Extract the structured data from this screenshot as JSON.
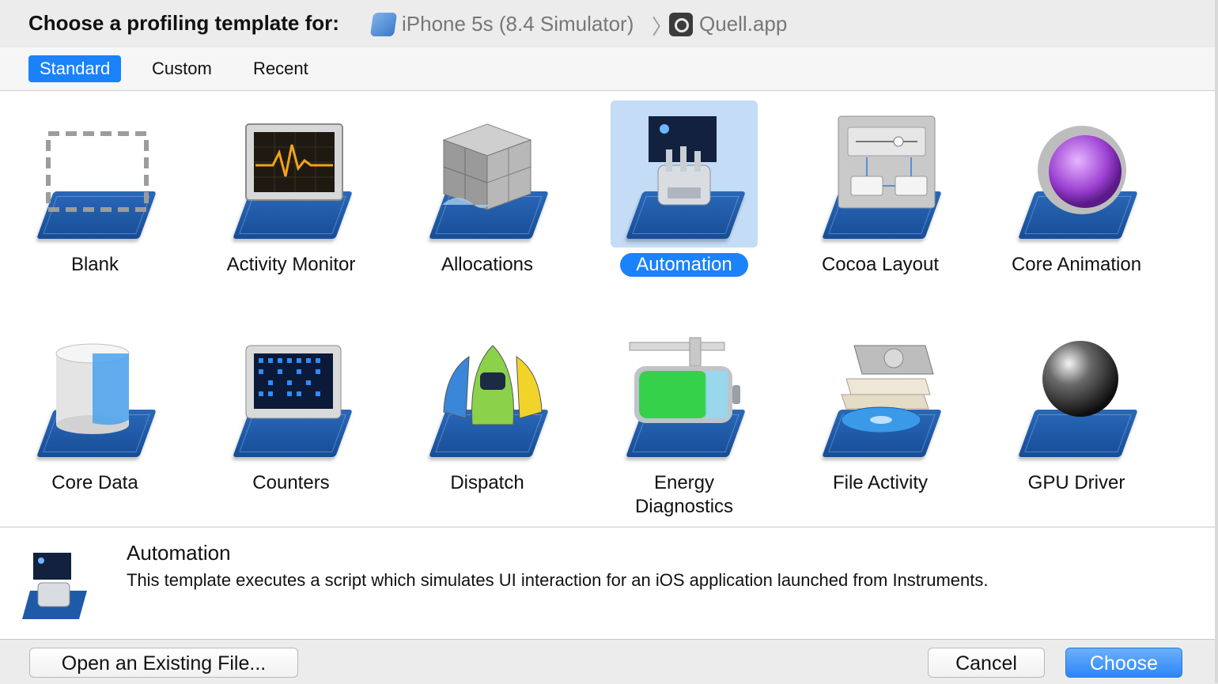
{
  "header": {
    "title": "Choose a profiling template for:",
    "device": "iPhone 5s (8.4 Simulator)",
    "separator": "〉",
    "app": "Quell.app"
  },
  "tabs": [
    {
      "label": "Standard",
      "active": true
    },
    {
      "label": "Custom",
      "active": false
    },
    {
      "label": "Recent",
      "active": false
    }
  ],
  "search": {
    "value": "",
    "placeholder": ""
  },
  "templates": [
    {
      "label": "Blank",
      "icon": "blank-icon"
    },
    {
      "label": "Activity Monitor",
      "icon": "activity-monitor-icon"
    },
    {
      "label": "Allocations",
      "icon": "allocations-icon"
    },
    {
      "label": "Automation",
      "icon": "automation-icon",
      "selected": true
    },
    {
      "label": "Cocoa Layout",
      "icon": "cocoa-layout-icon"
    },
    {
      "label": "Core Animation",
      "icon": "core-animation-icon"
    },
    {
      "label": "Core Data",
      "icon": "core-data-icon"
    },
    {
      "label": "Counters",
      "icon": "counters-icon"
    },
    {
      "label": "Dispatch",
      "icon": "dispatch-icon"
    },
    {
      "label": "Energy",
      "label2": "Diagnostics",
      "icon": "energy-diagnostics-icon"
    },
    {
      "label": "File Activity",
      "icon": "file-activity-icon"
    },
    {
      "label": "GPU Driver",
      "icon": "gpu-driver-icon"
    }
  ],
  "description": {
    "title": "Automation",
    "text": "This template executes a script which simulates UI interaction for an iOS application launched from Instruments."
  },
  "footer": {
    "open_label": "Open an Existing File...",
    "cancel_label": "Cancel",
    "choose_label": "Choose"
  },
  "colors": {
    "accent": "#1a82fb",
    "selection_tile": "#c4dcf6",
    "pad": "#1f5aa8"
  }
}
